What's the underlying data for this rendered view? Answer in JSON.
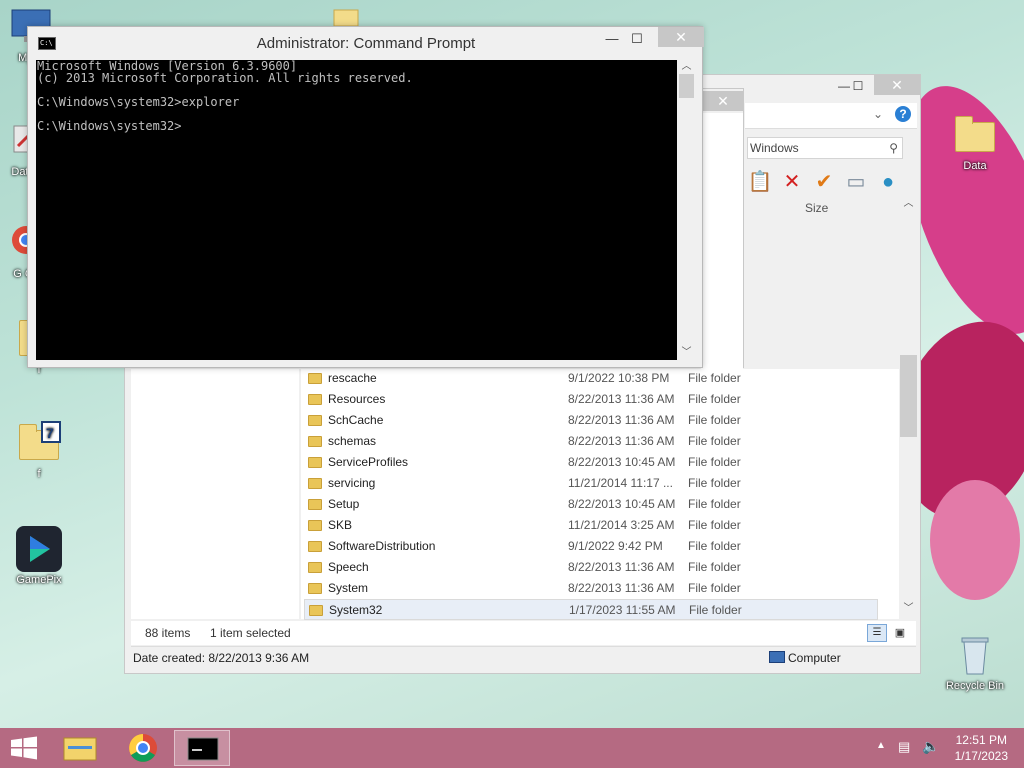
{
  "desktop": {
    "icons": [
      {
        "label": "My C",
        "icon": "computer-icon"
      },
      {
        "label": "Data",
        "icon": "shortcut-icon"
      },
      {
        "label": "G C",
        "icon": "chrome-icon"
      },
      {
        "label": "f",
        "icon": "folder-icon"
      },
      {
        "label": "f",
        "icon": "folder-7z-icon"
      },
      {
        "label": "GamePix",
        "icon": "gamepix-icon"
      },
      {
        "label": "Data",
        "icon": "folder-icon"
      },
      {
        "label": "Recycle Bin",
        "icon": "recycle-bin-icon"
      }
    ]
  },
  "cmd": {
    "title": "Administrator:  Command Prompt",
    "lines": [
      "Microsoft Windows [Version 6.3.9600]",
      "(c) 2013 Microsoft Corporation. All rights reserved.",
      "",
      "C:\\Windows\\system32>explorer",
      "",
      "C:\\Windows\\system32>"
    ],
    "controls": {
      "minimize": "—",
      "maximize": "☐",
      "close": "✕"
    }
  },
  "explorer": {
    "search_text": "Windows",
    "column_size": "Size",
    "files": [
      {
        "name": "rescache",
        "date": "9/1/2022 10:38 PM",
        "type": "File folder"
      },
      {
        "name": "Resources",
        "date": "8/22/2013 11:36 AM",
        "type": "File folder"
      },
      {
        "name": "SchCache",
        "date": "8/22/2013 11:36 AM",
        "type": "File folder"
      },
      {
        "name": "schemas",
        "date": "8/22/2013 11:36 AM",
        "type": "File folder"
      },
      {
        "name": "ServiceProfiles",
        "date": "8/22/2013 10:45 AM",
        "type": "File folder"
      },
      {
        "name": "servicing",
        "date": "11/21/2014 11:17 ...",
        "type": "File folder"
      },
      {
        "name": "Setup",
        "date": "8/22/2013 10:45 AM",
        "type": "File folder"
      },
      {
        "name": "SKB",
        "date": "11/21/2014 3:25 AM",
        "type": "File folder"
      },
      {
        "name": "SoftwareDistribution",
        "date": "9/1/2022 9:42 PM",
        "type": "File folder"
      },
      {
        "name": "Speech",
        "date": "8/22/2013 11:36 AM",
        "type": "File folder"
      },
      {
        "name": "System",
        "date": "8/22/2013 11:36 AM",
        "type": "File folder"
      },
      {
        "name": "System32",
        "date": "1/17/2023 11:55 AM",
        "type": "File folder"
      }
    ],
    "item_count": "88 items",
    "selected_count": "1 item selected",
    "date_created": "Date created: 8/22/2013 9:36 AM",
    "location": "Computer"
  },
  "taskbar": {
    "time": "12:51 PM",
    "date": "1/17/2023"
  }
}
